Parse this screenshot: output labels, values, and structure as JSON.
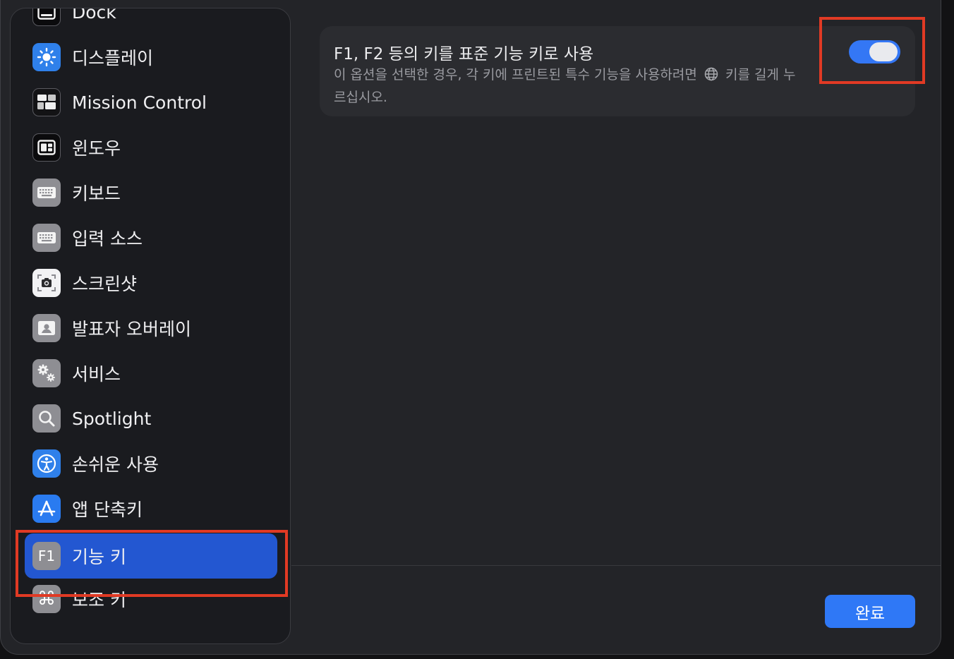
{
  "sidebar": {
    "items": [
      {
        "label": "Dock",
        "icon": "dock-icon"
      },
      {
        "label": "디스플레이",
        "icon": "display-brightness-icon"
      },
      {
        "label": "Mission Control",
        "icon": "mission-control-icon"
      },
      {
        "label": "윈도우",
        "icon": "window-icon"
      },
      {
        "label": "키보드",
        "icon": "keyboard-icon"
      },
      {
        "label": "입력 소스",
        "icon": "input-sources-keyboard-icon"
      },
      {
        "label": "스크린샷",
        "icon": "screenshot-camera-icon"
      },
      {
        "label": "발표자 오버레이",
        "icon": "presenter-overlay-icon"
      },
      {
        "label": "서비스",
        "icon": "services-gear-icon"
      },
      {
        "label": "Spotlight",
        "icon": "spotlight-magnifier-icon"
      },
      {
        "label": "손쉬운 사용",
        "icon": "accessibility-icon"
      },
      {
        "label": "앱 단축키",
        "icon": "app-store-icon"
      },
      {
        "label": "기능 키",
        "icon": "f1-key-icon",
        "icon_text": "F1",
        "selected": true
      },
      {
        "label": "보조 키",
        "icon": "command-key-icon"
      }
    ]
  },
  "setting": {
    "title": "F1, F2 등의 키를 표준 기능 키로 사용",
    "description_before_icon": "이 옵션을 선택한 경우, 각 키에 프린트된 특수 기능을 사용하려면",
    "description_after_icon": "키를 길게 누르십시오.",
    "toggle_on": true
  },
  "footer": {
    "done_label": "완료"
  },
  "colors": {
    "accent": "#2f78f6",
    "selection": "#2357d1",
    "highlight": "#e13a24"
  }
}
